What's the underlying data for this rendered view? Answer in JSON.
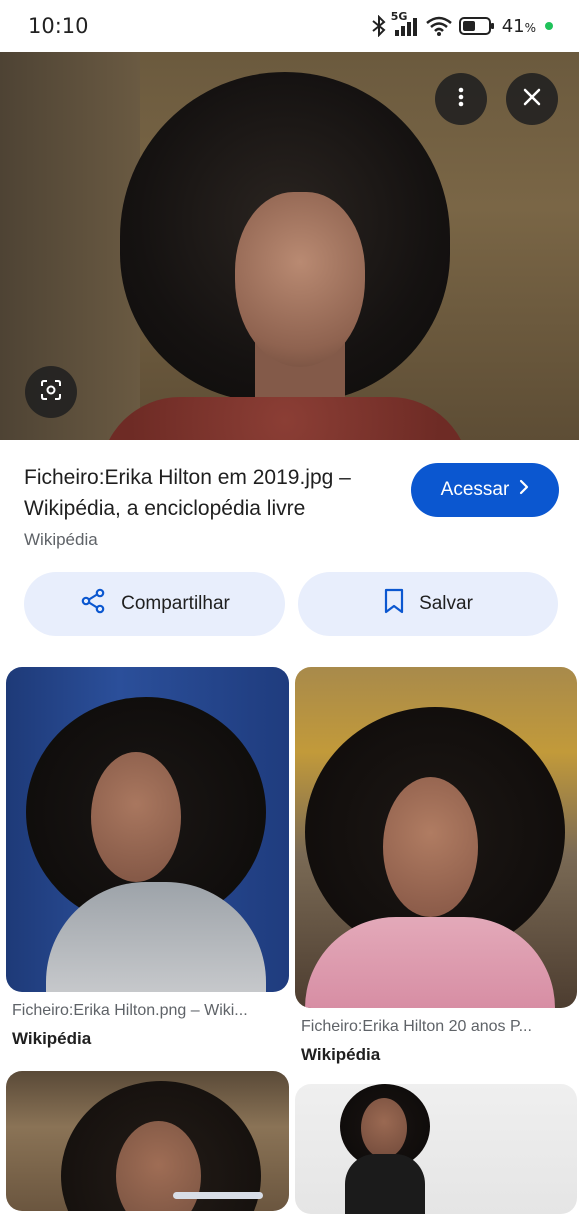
{
  "status_bar": {
    "time": "10:10",
    "network": "5G",
    "battery_percent": "41",
    "battery_unit": "%"
  },
  "hero": {
    "more_icon": "more-vert-icon",
    "close_icon": "close-icon",
    "lens_icon": "lens-icon"
  },
  "result": {
    "title": "Ficheiro:Erika Hilton em 2019.jpg – Wikipédia, a enciclopédia livre",
    "source": "Wikipédia",
    "visit_label": "Acessar"
  },
  "actions": {
    "share_label": "Compartilhar",
    "save_label": "Salvar"
  },
  "related": [
    {
      "caption": "Ficheiro:Erika Hilton.png – Wiki...",
      "source": "Wikipédia"
    },
    {
      "caption": "Ficheiro:Erika Hilton 20 anos P...",
      "source": "Wikipédia"
    }
  ],
  "colors": {
    "accent": "#0b57d0",
    "action_bg": "#e8eefc",
    "battery_dot": "#1fc25a"
  }
}
